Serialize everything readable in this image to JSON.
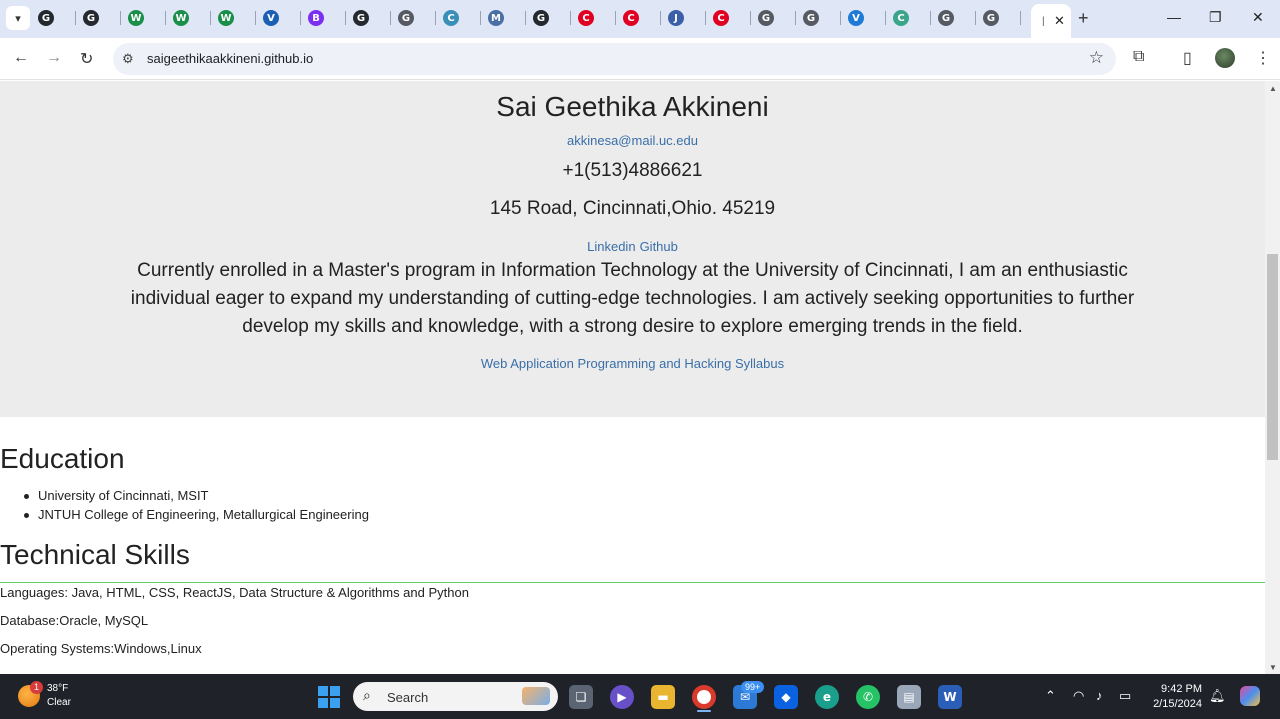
{
  "browser": {
    "tabs": [
      {
        "icon": "github-icon",
        "title": "G",
        "color": "#24292f"
      },
      {
        "icon": "github-icon",
        "title": "G",
        "color": "#24292f"
      },
      {
        "icon": "w-icon",
        "title": "W",
        "color": "#1a8f4a"
      },
      {
        "icon": "w-icon",
        "title": "W",
        "color": "#1a8f4a"
      },
      {
        "icon": "w-icon",
        "title": "W",
        "color": "#1a8f4a"
      },
      {
        "icon": "video-icon",
        "title": "V",
        "color": "#1b5fb5"
      },
      {
        "icon": "b-icon",
        "title": "B",
        "color": "#7b2ff2"
      },
      {
        "icon": "github-icon",
        "title": "G",
        "color": "#24292f"
      },
      {
        "icon": "globe-icon",
        "title": "G",
        "color": "#555a63"
      },
      {
        "icon": "circle-icon",
        "title": "C",
        "color": "#3a8fb8"
      },
      {
        "icon": "monitor-icon",
        "title": "M",
        "color": "#4a6fa5"
      },
      {
        "icon": "github-icon",
        "title": "G",
        "color": "#24292f"
      },
      {
        "icon": "uc-icon",
        "title": "C",
        "color": "#e00122"
      },
      {
        "icon": "uc-icon",
        "title": "C",
        "color": "#e00122"
      },
      {
        "icon": "j-icon",
        "title": "J",
        "color": "#3b5fa8"
      },
      {
        "icon": "uc-icon",
        "title": "C",
        "color": "#e00122"
      },
      {
        "icon": "globe-icon",
        "title": "G",
        "color": "#555a63"
      },
      {
        "icon": "globe-icon",
        "title": "G",
        "color": "#555a63"
      },
      {
        "icon": "vscode-icon",
        "title": "V",
        "color": "#1f7ad6"
      },
      {
        "icon": "chatgpt-icon",
        "title": "C",
        "color": "#3aa58a"
      },
      {
        "icon": "globe-icon",
        "title": "G",
        "color": "#555a63"
      },
      {
        "icon": "globe-icon",
        "title": "G",
        "color": "#555a63"
      }
    ],
    "url": "saigeethikaakkineni.github.io"
  },
  "profile": {
    "name": "Sai Geethika Akkineni",
    "email": "akkinesa@mail.uc.edu",
    "phone": "+1(513)4886621",
    "address": "145 Road, Cincinnati,Ohio. 45219",
    "links": [
      "Linkedin",
      "Github"
    ],
    "bio": "Currently enrolled in a Master's program in Information Technology at the University of Cincinnati, I am an enthusiastic individual eager to expand my understanding of cutting-edge technologies. I am actively seeking opportunities to further develop my skills and knowledge, with a strong desire to explore emerging trends in the field.",
    "syllabus_link": "Web Application Programming and Hacking Syllabus"
  },
  "education": {
    "heading": "Education",
    "items": [
      "University of Cincinnati, MSIT",
      "JNTUH College of Engineering, Metallurgical Engineering"
    ]
  },
  "skills": {
    "heading": "Technical Skills",
    "languages": "Languages: Java, HTML, CSS, ReactJS, Data Structure & Algorithms and Python",
    "database": "Database:Oracle, MySQL",
    "os": "Operating Systems:Windows,Linux"
  },
  "taskbar": {
    "weather_temp": "38°F",
    "weather_desc": "Clear",
    "weather_badge": "1",
    "search_label": "Search",
    "mail_badge": "99+",
    "time": "9:42 PM",
    "date": "2/15/2024"
  }
}
